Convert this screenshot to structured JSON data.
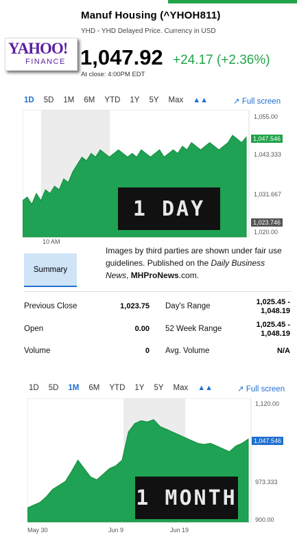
{
  "header": {
    "title": "Manuf Housing (^YHOH811)",
    "subtitle": "YHD - YHD Delayed Price. Currency in USD",
    "logo_text": "YAHOO!",
    "logo_sub": "FINANCE",
    "price": "1,047.92",
    "change": "+24.17 (+2.36%)",
    "close_time": "At close: 4:00PM EDT"
  },
  "colors": {
    "accent": "#1f6fd0",
    "up": "#21a34a",
    "chart_fill": "#1fa253",
    "session_bg": "#ececec"
  },
  "chart1": {
    "ranges": [
      "1D",
      "5D",
      "1M",
      "6M",
      "YTD",
      "1Y",
      "5Y",
      "Max"
    ],
    "active": "1D",
    "chart_icon": "mountain-chart-icon",
    "fullscreen": "Full screen",
    "overlay": "1 DAY",
    "xticks": [
      "10 AM"
    ],
    "yticks": [
      "1,055.00",
      "1,043.333",
      "1,031.667",
      "1,020.00"
    ],
    "current_badge": "1,047.546",
    "prev_badge": "1,023.746"
  },
  "notice": {
    "line1": "Images by third parties are shown under fair use guidelines.  Published on the ",
    "italic": "Daily Business News",
    "sep": ", ",
    "bold": "MHProNews",
    "end": ".com."
  },
  "summary_tab": "Summary",
  "stats": {
    "prev_close_label": "Previous Close",
    "prev_close": "1,023.75",
    "open_label": "Open",
    "open": "0.00",
    "volume_label": "Volume",
    "volume": "0",
    "days_range_label": "Day's Range",
    "days_range_1": "1,025.45 -",
    "days_range_2": "1,048.19",
    "week52_label": "52 Week Range",
    "week52_1": "1,025.45 -",
    "week52_2": "1,048.19",
    "avg_volume_label": "Avg. Volume",
    "avg_volume": "N/A"
  },
  "chart2": {
    "ranges": [
      "1D",
      "5D",
      "1M",
      "6M",
      "YTD",
      "1Y",
      "5Y",
      "Max"
    ],
    "active": "1M",
    "chart_icon": "mountain-chart-icon",
    "fullscreen": "Full screen",
    "overlay": "1 MONTH",
    "xticks": [
      "May 30",
      "Jun 9",
      "Jun 19"
    ],
    "yticks": [
      "1,120.00",
      "973.333",
      "900.00"
    ],
    "current_badge": "1,047.546"
  },
  "chart_data": [
    {
      "type": "area",
      "title": "1D",
      "ylim": [
        1020,
        1055
      ],
      "values": [
        1030,
        1031,
        1029,
        1032,
        1030,
        1033,
        1032,
        1034,
        1033,
        1036,
        1035,
        1038,
        1040,
        1042,
        1041,
        1043,
        1042,
        1044,
        1043,
        1042,
        1043,
        1044,
        1043,
        1042,
        1043,
        1042,
        1044,
        1043,
        1042,
        1043,
        1044,
        1042,
        1043,
        1044,
        1043,
        1045,
        1044,
        1046,
        1045,
        1044,
        1045,
        1046,
        1045,
        1044,
        1045,
        1046,
        1048,
        1047,
        1046,
        1047.5
      ]
    },
    {
      "type": "area",
      "title": "1M",
      "ylim": [
        900,
        1120
      ],
      "values": [
        925,
        930,
        935,
        945,
        958,
        965,
        972,
        990,
        1010,
        995,
        980,
        975,
        985,
        995,
        1000,
        1010,
        1060,
        1075,
        1080,
        1078,
        1082,
        1070,
        1065,
        1060,
        1055,
        1050,
        1045,
        1040,
        1038,
        1040,
        1035,
        1030,
        1025,
        1035,
        1040,
        1047.5
      ]
    }
  ]
}
